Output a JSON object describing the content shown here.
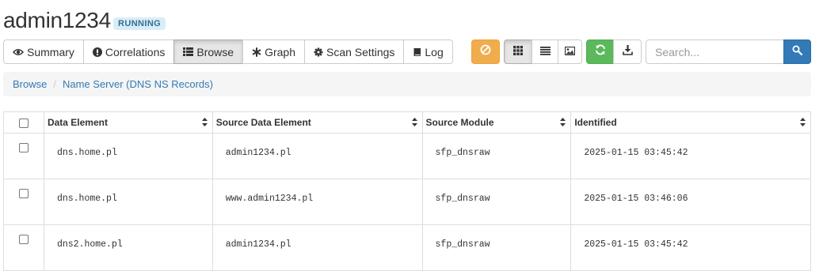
{
  "scan": {
    "name": "admin1234",
    "status": "RUNNING"
  },
  "tabs": [
    {
      "label": "Summary",
      "icon": "eye-icon"
    },
    {
      "label": "Correlations",
      "icon": "exclamation-circle-icon"
    },
    {
      "label": "Browse",
      "icon": "list-icon",
      "active": true
    },
    {
      "label": "Graph",
      "icon": "asterisk-icon"
    },
    {
      "label": "Scan Settings",
      "icon": "gear-icon"
    },
    {
      "label": "Log",
      "icon": "book-icon"
    }
  ],
  "toolbar": {
    "stop_icon": "ban-icon",
    "view_icons": [
      "grid-icon",
      "list-icon",
      "image-icon"
    ],
    "refresh_icon": "refresh-icon",
    "download_icon": "download-icon"
  },
  "search": {
    "placeholder": "Search...",
    "value": ""
  },
  "breadcrumb": {
    "root": "Browse",
    "current": "Name Server (DNS NS Records)"
  },
  "table": {
    "columns": [
      "Data Element",
      "Source Data Element",
      "Source Module",
      "Identified"
    ],
    "rows": [
      [
        "dns.home.pl",
        "admin1234.pl",
        "sfp_dnsraw",
        "2025-01-15 03:45:42"
      ],
      [
        "dns.home.pl",
        "www.admin1234.pl",
        "sfp_dnsraw",
        "2025-01-15 03:46:06"
      ],
      [
        "dns2.home.pl",
        "admin1234.pl",
        "sfp_dnsraw",
        "2025-01-15 03:45:42"
      ]
    ]
  },
  "colors": {
    "warning": "#f0ad4e",
    "success": "#5cb85c",
    "primary": "#337ab7",
    "badge_bg": "#d9edf7",
    "badge_text": "#31708f"
  }
}
